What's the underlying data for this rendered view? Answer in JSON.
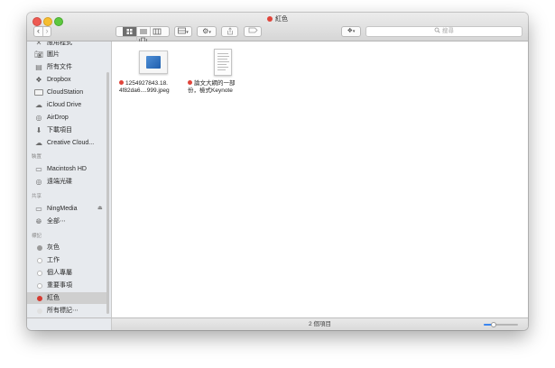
{
  "window": {
    "title": "紅色"
  },
  "toolbar": {
    "back": "‹",
    "forward": "›",
    "arrange_caret": "▾",
    "action_caret": "▾",
    "dropbox_caret": "▾"
  },
  "search": {
    "placeholder": "搜尋"
  },
  "sidebar": {
    "favorites": [
      {
        "label": "應用程式",
        "icon": "applications-icon"
      },
      {
        "label": "圖片",
        "icon": "pictures-icon"
      },
      {
        "label": "所有文件",
        "icon": "all-files-icon"
      },
      {
        "label": "Dropbox",
        "icon": "dropbox-icon"
      },
      {
        "label": "CloudStation",
        "icon": "folder-icon"
      },
      {
        "label": "iCloud Drive",
        "icon": "cloud-icon"
      },
      {
        "label": "AirDrop",
        "icon": "airdrop-icon"
      },
      {
        "label": "下載項目",
        "icon": "downloads-icon"
      },
      {
        "label": "Creative Cloud...",
        "icon": "creative-cloud-icon"
      }
    ],
    "devices_heading": "裝置",
    "devices": [
      {
        "label": "Macintosh HD",
        "icon": "harddisk-icon"
      },
      {
        "label": "遠端光碟",
        "icon": "remote-disc-icon"
      }
    ],
    "shared_heading": "共享",
    "shared": [
      {
        "label": "NingMedia",
        "icon": "server-icon",
        "eject": "⏏"
      },
      {
        "label": "全部⋯",
        "icon": "network-icon"
      }
    ],
    "tags_heading": "標記",
    "tags": [
      {
        "label": "灰色",
        "color": "#9a9a9a"
      },
      {
        "label": "工作",
        "color": "#ffffff"
      },
      {
        "label": "個人專屬",
        "color": "#ffffff"
      },
      {
        "label": "重要事項",
        "color": "#ffffff"
      },
      {
        "label": "紅色",
        "color": "#d63a31",
        "selected": true
      },
      {
        "label": "所有標記⋯",
        "color": "#e0e0e0"
      }
    ]
  },
  "files": [
    {
      "name_line1": "1254927843.18.",
      "name_line2": "4f82da6....999.jpeg",
      "tag_color": "#e0443a",
      "kind": "image"
    },
    {
      "name_line1": "論文大綱的一部",
      "name_line2": "份，檢式Keynote",
      "tag_color": "#e0443a",
      "kind": "document"
    }
  ],
  "status": {
    "text": "2 個項目",
    "zoom_level": 0.3
  },
  "colors": {
    "accent": "#3a86f0",
    "tag_red": "#e0443a"
  }
}
